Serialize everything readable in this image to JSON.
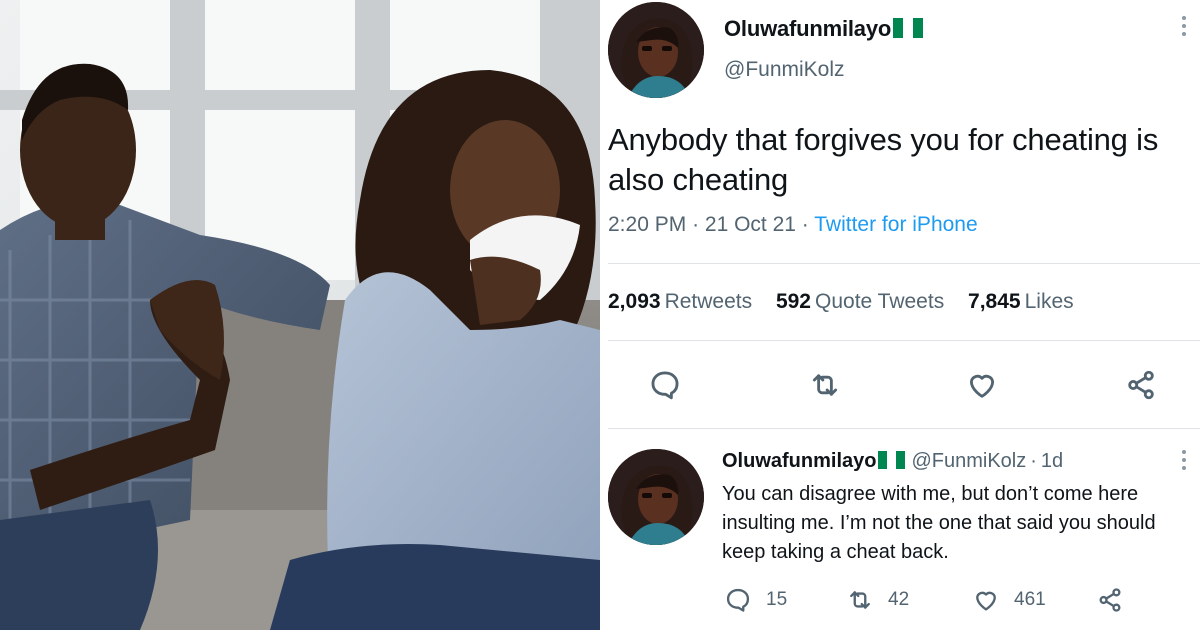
{
  "tweet": {
    "author_name": "Oluwafunmilayo",
    "author_handle": "@FunmiKolz",
    "author_flag": "nigeria-flag",
    "text_lines": [
      "Anybody that forgives you for cheating is",
      "also cheating"
    ],
    "time": "2:20 PM",
    "date": "21 Oct 21",
    "source": "Twitter for iPhone",
    "stats": {
      "retweets_count": "2,093",
      "retweets_label": "Retweets",
      "quotes_count": "592",
      "quotes_label": "Quote Tweets",
      "likes_count": "7,845",
      "likes_label": "Likes"
    },
    "actions": [
      "reply-icon",
      "retweet-icon",
      "like-icon",
      "share-icon"
    ]
  },
  "reply": {
    "author_name": "Oluwafunmilayo",
    "author_handle": "@FunmiKolz",
    "age": "1d",
    "text_lines": [
      "You can disagree with me, but don’t come here",
      "insulting me. I’m not the one that said you should",
      "keep taking a cheat back."
    ],
    "reply_count": "15",
    "retweet_count": "42",
    "like_count": "461"
  },
  "colors": {
    "accent": "#1d9bf0",
    "muted_text": "#536471",
    "primary_text": "#0f1419",
    "flag_green": "#008751"
  }
}
